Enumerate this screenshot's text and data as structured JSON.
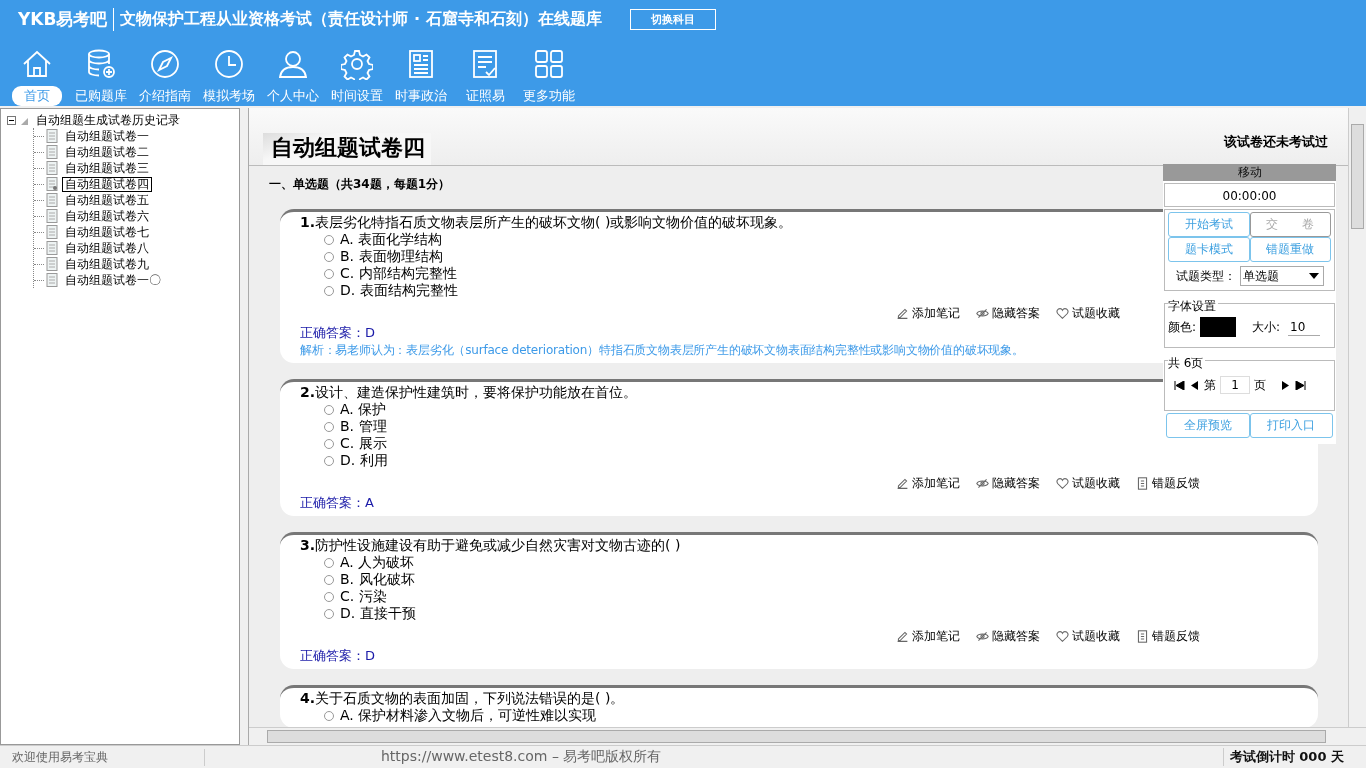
{
  "header": {
    "logo": "YKB易考吧",
    "title": "文物保护工程从业资格考试（责任设计师 · 石窟寺和石刻）在线题库",
    "switch_button": "切换科目"
  },
  "nav": [
    {
      "label": "首页",
      "selected": true
    },
    {
      "label": "已购题库",
      "selected": false
    },
    {
      "label": "介绍指南",
      "selected": false
    },
    {
      "label": "模拟考场",
      "selected": false
    },
    {
      "label": "个人中心",
      "selected": false
    },
    {
      "label": "时间设置",
      "selected": false
    },
    {
      "label": "时事政治",
      "selected": false
    },
    {
      "label": "证照易",
      "selected": false
    },
    {
      "label": "更多功能",
      "selected": false
    }
  ],
  "tree": {
    "label": "自动组题生成试卷历史记录",
    "expanded": true,
    "children": [
      {
        "label": "自动组题试卷一",
        "selected": false
      },
      {
        "label": "自动组题试卷二",
        "selected": false
      },
      {
        "label": "自动组题试卷三",
        "selected": false
      },
      {
        "label": "自动组题试卷四",
        "selected": true
      },
      {
        "label": "自动组题试卷五",
        "selected": false
      },
      {
        "label": "自动组题试卷六",
        "selected": false
      },
      {
        "label": "自动组题试卷七",
        "selected": false
      },
      {
        "label": "自动组题试卷八",
        "selected": false
      },
      {
        "label": "自动组题试卷九",
        "selected": false
      },
      {
        "label": "自动组题试卷一〇",
        "selected": false
      }
    ]
  },
  "paper": {
    "title": "自动组题试卷四",
    "status": "该试卷还未考试过",
    "section": "一、单选题（共34题，每题1分）",
    "questions": [
      {
        "number": "1.",
        "text": "表层劣化特指石质文物表层所产生的破坏文物( )或影响文物价值的破坏现象。",
        "options": [
          {
            "letter": "A.",
            "text": "表面化学结构",
            "selected": false
          },
          {
            "letter": "B.",
            "text": "表面物理结构",
            "selected": false
          },
          {
            "letter": "C.",
            "text": "内部结构完整性",
            "selected": false
          },
          {
            "letter": "D.",
            "text": "表面结构完整性",
            "selected": false
          }
        ],
        "actions": [
          "添加笔记",
          "隐藏答案",
          "试题收藏"
        ],
        "answer_label": "正确答案：",
        "answer": "D",
        "analysis": "解析：易老师认为：表层劣化（surface deterioration）特指石质文物表层所产生的破坏文物表面结构完整性或影响文物价值的破坏现象。"
      },
      {
        "number": "2.",
        "text": "设计、建造保护性建筑时，要将保护功能放在首位。",
        "options": [
          {
            "letter": "A.",
            "text": "保护",
            "selected": false
          },
          {
            "letter": "B.",
            "text": "管理",
            "selected": false
          },
          {
            "letter": "C.",
            "text": "展示",
            "selected": false
          },
          {
            "letter": "D.",
            "text": "利用",
            "selected": false
          }
        ],
        "actions": [
          "添加笔记",
          "隐藏答案",
          "试题收藏",
          "错题反馈"
        ],
        "answer_label": "正确答案：",
        "answer": "A"
      },
      {
        "number": "3.",
        "text": "防护性设施建设有助于避免或减少自然灾害对文物古迹的( )",
        "options": [
          {
            "letter": "A.",
            "text": "人为破坏",
            "selected": false
          },
          {
            "letter": "B.",
            "text": "风化破坏",
            "selected": false
          },
          {
            "letter": "C.",
            "text": "污染",
            "selected": false
          },
          {
            "letter": "D.",
            "text": "直接干预",
            "selected": false
          }
        ],
        "actions": [
          "添加笔记",
          "隐藏答案",
          "试题收藏",
          "错题反馈"
        ],
        "answer_label": "正确答案：",
        "answer": "D"
      },
      {
        "number": "4.",
        "text": "关于石质文物的表面加固，下列说法错误的是( )。",
        "options": [
          {
            "letter": "A.",
            "text": "保护材料渗入文物后，可逆性难以实现",
            "selected": false
          }
        ]
      }
    ]
  },
  "panel": {
    "title": "移动",
    "timer": "00:00:00",
    "buttons": [
      {
        "label": "开始考试",
        "disabled": false
      },
      {
        "label": "交　　卷",
        "disabled": true
      },
      {
        "label": "题卡模式",
        "disabled": false
      },
      {
        "label": "错题重做",
        "disabled": false
      }
    ],
    "type_label": "试题类型：",
    "type_value": "单选题",
    "font_group": "字体设置",
    "color_label": "颜色:",
    "size_label": "大小:",
    "size_value": "10",
    "pages_group": "共 6页",
    "page_prefix": "第",
    "page_value": "1",
    "page_suffix": "页",
    "bottom_buttons": [
      "全屏预览",
      "打印入口"
    ]
  },
  "status_bar": {
    "welcome": "欢迎使用易考宝典",
    "copyright": "https://www.etest8.com – 易考吧版权所有",
    "countdown": "考试倒计时 000 天"
  }
}
